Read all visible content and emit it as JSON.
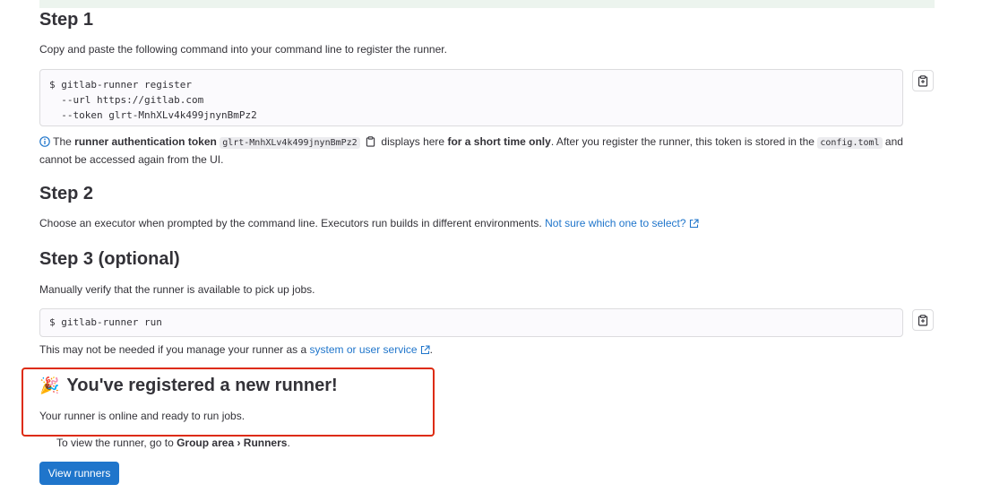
{
  "step1": {
    "title": "Step 1",
    "description": "Copy and paste the following command into your command line to register the runner.",
    "command_lines": [
      "$ gitlab-runner register",
      "  --url https://gitlab.com",
      "  --token glrt-MnhXLv4k499jnynBmPz2"
    ],
    "info_prefix": "The",
    "info_bold": "runner authentication token",
    "token": "glrt-MnhXLv4k499jnynBmPz2",
    "info_mid": "displays here",
    "info_bold2": "for a short time only",
    "info_after": ". After you register the runner, this token is stored in the",
    "config_file": "config.toml",
    "info_end": "and cannot be accessed again from the UI."
  },
  "step2": {
    "title": "Step 2",
    "description": "Choose an executor when prompted by the command line. Executors run builds in different environments.",
    "link": "Not sure which one to select?"
  },
  "step3": {
    "title": "Step 3 (optional)",
    "description": "Manually verify that the runner is available to pick up jobs.",
    "command": "$ gitlab-runner run",
    "note_prefix": "This may not be needed if you manage your runner as a",
    "note_link": "system or user service",
    "note_suffix": "."
  },
  "success": {
    "emoji": "🎉",
    "title": "You've registered a new runner!",
    "description": "Your runner is online and ready to run jobs.",
    "view_prefix": "To view the runner, go to",
    "view_path": "Group area › Runners",
    "view_suffix": ".",
    "button": "View runners"
  },
  "colors": {
    "accent": "#1f75cb",
    "highlight_border": "#dd2b0e"
  }
}
